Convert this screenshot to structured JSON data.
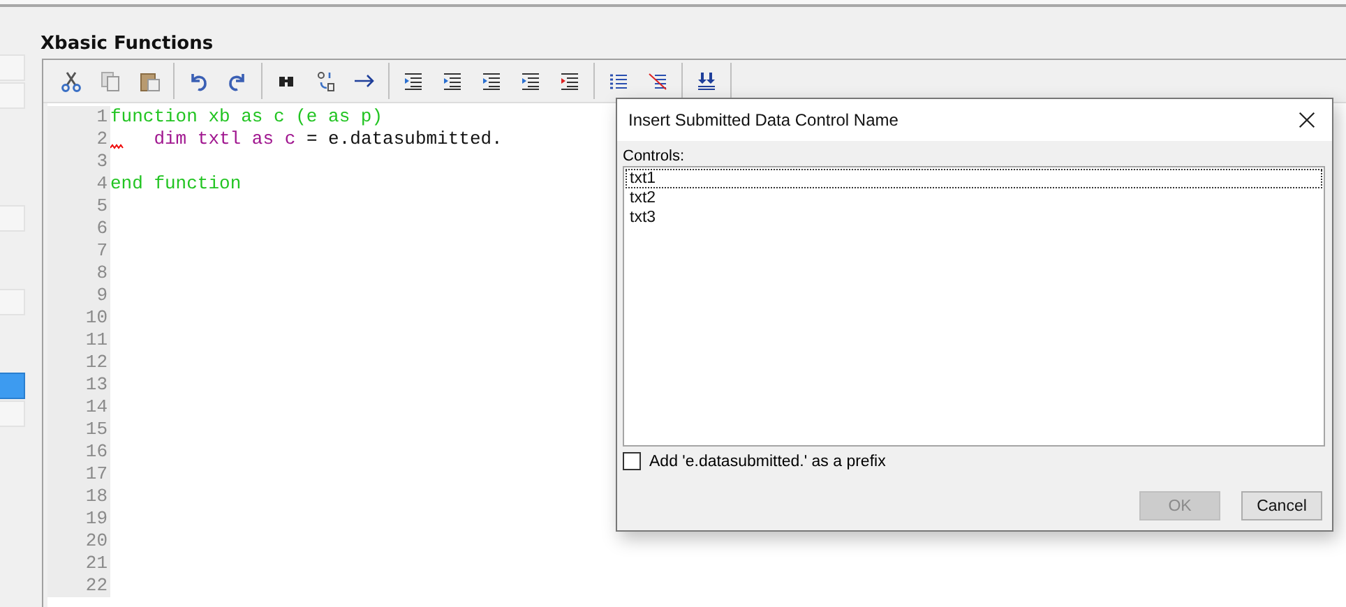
{
  "side_buttons": [
    {
      "selected": false
    },
    {
      "selected": false
    },
    {
      "selected": false
    },
    {
      "selected": false
    },
    {
      "selected": true
    },
    {
      "selected": false
    }
  ],
  "panel": {
    "title": "Xbasic Functions"
  },
  "editor": {
    "lines": [
      {
        "number": "1",
        "error": false,
        "segments": [
          {
            "kind": "keyword",
            "text": "function xb as c (e as p)"
          }
        ]
      },
      {
        "number": "2",
        "error": true,
        "indent": true,
        "segments": [
          {
            "kind": "variable",
            "text": "dim txtl as c"
          },
          {
            "kind": "plain",
            "text": "= e.datasubmitted."
          }
        ]
      },
      {
        "number": "3",
        "error": false
      },
      {
        "number": "4",
        "error": false,
        "segments": [
          {
            "kind": "keyword",
            "text": "end function"
          }
        ]
      },
      {
        "number": "5",
        "error": false
      },
      {
        "number": "6",
        "error": false
      },
      {
        "number": "7",
        "error": false
      },
      {
        "number": "8",
        "error": false
      },
      {
        "number": "9",
        "error": false
      },
      {
        "number": "10",
        "error": false
      },
      {
        "number": "11",
        "error": false
      },
      {
        "number": "12",
        "error": false
      },
      {
        "number": "13",
        "error": false
      },
      {
        "number": "14",
        "error": false
      },
      {
        "number": "15",
        "error": false
      },
      {
        "number": "16",
        "error": false
      },
      {
        "number": "17",
        "error": false
      },
      {
        "number": "18",
        "error": false
      },
      {
        "number": "19",
        "error": false
      },
      {
        "number": "20",
        "error": false
      },
      {
        "number": "21",
        "error": false
      },
      {
        "number": "22",
        "error": false
      }
    ]
  },
  "dialog": {
    "title": "Insert Submitted Data Control Name",
    "list_label": "Controls:",
    "controls": [
      {
        "text": "txt1",
        "selected": true
      },
      {
        "text": "txt2",
        "selected": false
      },
      {
        "text": "txt3",
        "selected": false
      }
    ],
    "prefix_option": {
      "label": "Add 'e.datasubmitted.' as a prefix",
      "checked": false
    },
    "buttons": [
      {
        "label": "OK",
        "disabled": true
      },
      {
        "label": "Cancel",
        "disabled": false
      }
    ]
  }
}
